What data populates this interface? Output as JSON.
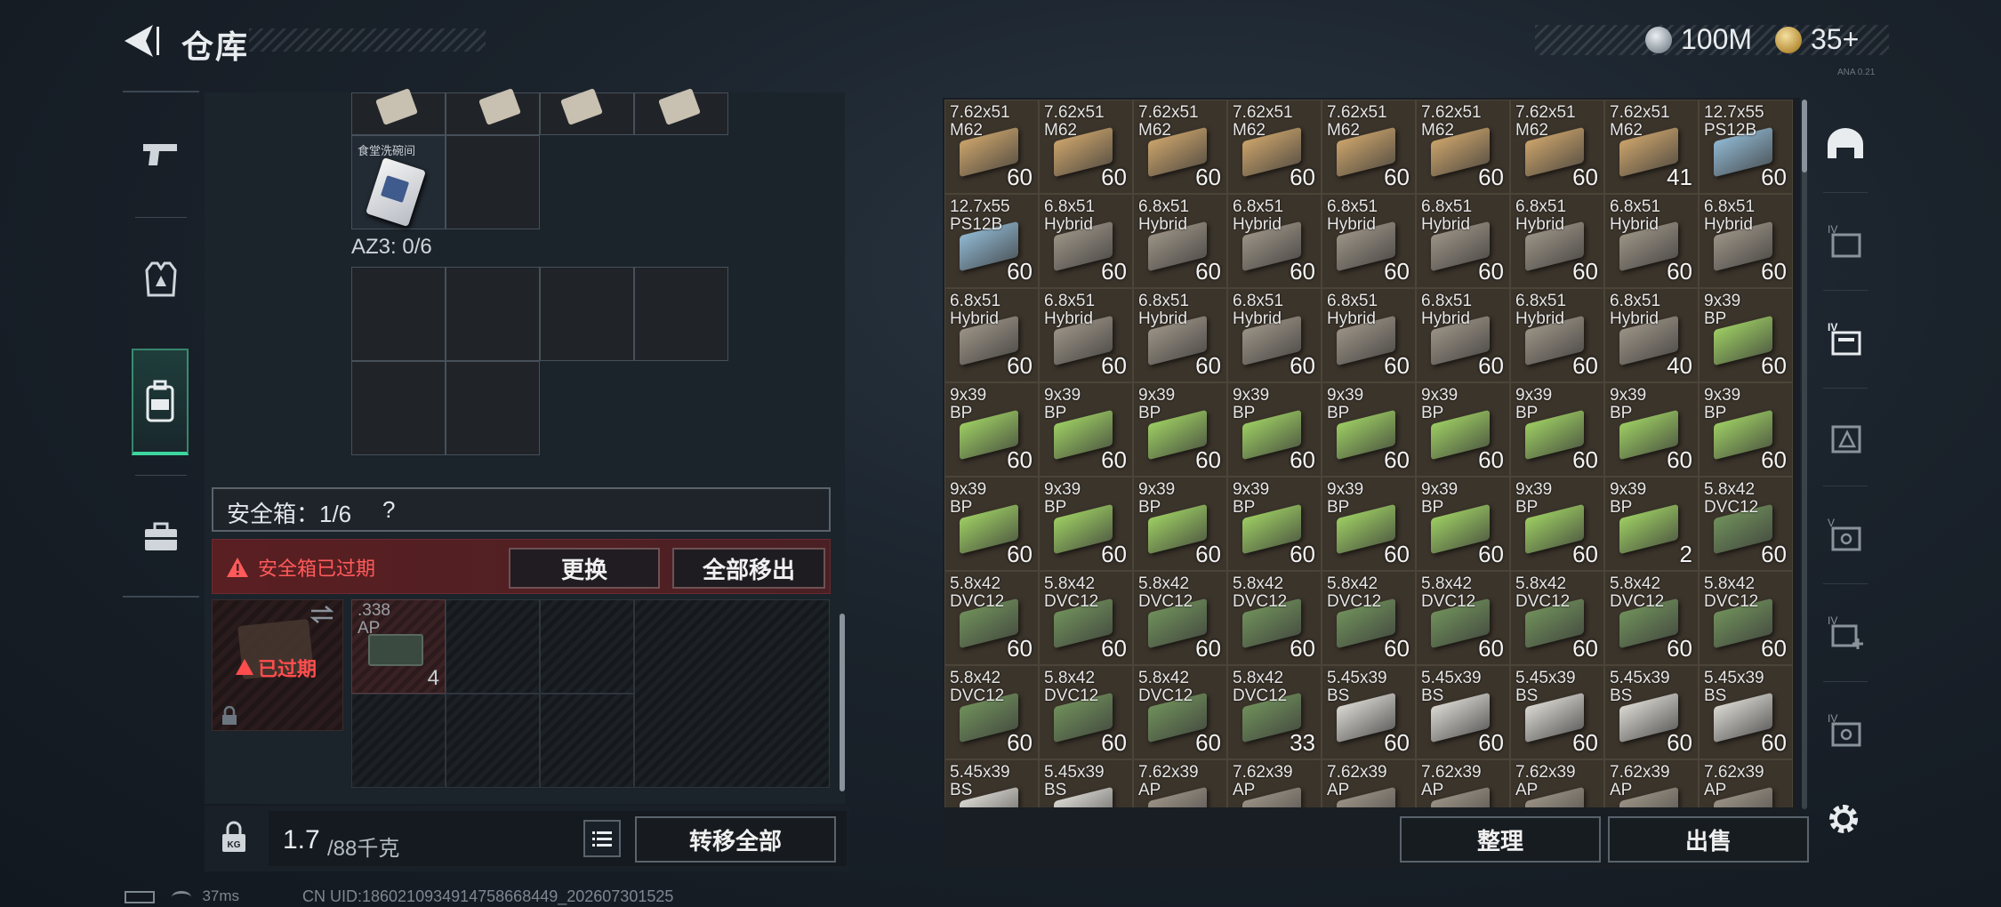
{
  "header": {
    "title": "仓库",
    "silver_value": "100M",
    "gold_value": "35+",
    "version_text": "ANA 0.21"
  },
  "left_nav": {
    "items": [
      {
        "name": "weapon-icon"
      },
      {
        "name": "vest-icon"
      },
      {
        "name": "backpack-icon",
        "active": true
      },
      {
        "name": "toolbox-icon"
      }
    ]
  },
  "container": {
    "item_label": "食堂洗碗间",
    "az3_label": "AZ3: 0/6",
    "safe_label": "安全箱：1/6",
    "help_mark": "?",
    "warning": "安全箱已过期",
    "replace_btn": "更换",
    "remove_all_btn": "全部移出",
    "expired_label": "已过期",
    "safe_item": {
      "name": ".338",
      "name2": "AP",
      "count": "4"
    }
  },
  "weight": {
    "current": "1.7",
    "max": "/88千克",
    "kg_badge": "KG"
  },
  "transfer_all_btn": "转移全部",
  "sort_btn": "整理",
  "sell_btn": "出售",
  "colors": {
    "tan_box": "#c9a26a",
    "blue_box": "#8fb6cf",
    "grey_box": "#9a9184",
    "green_box": "#9ccc62",
    "dark_green_box": "#6f8f5a",
    "white_box": "#d8d6d0",
    "warning_red": "#ff5a5a",
    "active_green": "#3dd6a0"
  },
  "stash": {
    "rows": [
      [
        {
          "n1": "7.62x51",
          "n2": "M62",
          "c": "60",
          "color": "tan"
        },
        {
          "n1": "7.62x51",
          "n2": "M62",
          "c": "60",
          "color": "tan"
        },
        {
          "n1": "7.62x51",
          "n2": "M62",
          "c": "60",
          "color": "tan"
        },
        {
          "n1": "7.62x51",
          "n2": "M62",
          "c": "60",
          "color": "tan"
        },
        {
          "n1": "7.62x51",
          "n2": "M62",
          "c": "60",
          "color": "tan"
        },
        {
          "n1": "7.62x51",
          "n2": "M62",
          "c": "60",
          "color": "tan"
        },
        {
          "n1": "7.62x51",
          "n2": "M62",
          "c": "60",
          "color": "tan"
        },
        {
          "n1": "7.62x51",
          "n2": "M62",
          "c": "41",
          "color": "tan"
        },
        {
          "n1": "12.7x55",
          "n2": "PS12B",
          "c": "60",
          "color": "blue"
        }
      ],
      [
        {
          "n1": "12.7x55",
          "n2": "PS12B",
          "c": "60",
          "color": "blue"
        },
        {
          "n1": "6.8x51",
          "n2": "Hybrid",
          "c": "60",
          "color": "grey"
        },
        {
          "n1": "6.8x51",
          "n2": "Hybrid",
          "c": "60",
          "color": "grey"
        },
        {
          "n1": "6.8x51",
          "n2": "Hybrid",
          "c": "60",
          "color": "grey"
        },
        {
          "n1": "6.8x51",
          "n2": "Hybrid",
          "c": "60",
          "color": "grey"
        },
        {
          "n1": "6.8x51",
          "n2": "Hybrid",
          "c": "60",
          "color": "grey"
        },
        {
          "n1": "6.8x51",
          "n2": "Hybrid",
          "c": "60",
          "color": "grey"
        },
        {
          "n1": "6.8x51",
          "n2": "Hybrid",
          "c": "60",
          "color": "grey"
        },
        {
          "n1": "6.8x51",
          "n2": "Hybrid",
          "c": "60",
          "color": "grey"
        }
      ],
      [
        {
          "n1": "6.8x51",
          "n2": "Hybrid",
          "c": "60",
          "color": "grey"
        },
        {
          "n1": "6.8x51",
          "n2": "Hybrid",
          "c": "60",
          "color": "grey"
        },
        {
          "n1": "6.8x51",
          "n2": "Hybrid",
          "c": "60",
          "color": "grey"
        },
        {
          "n1": "6.8x51",
          "n2": "Hybrid",
          "c": "60",
          "color": "grey"
        },
        {
          "n1": "6.8x51",
          "n2": "Hybrid",
          "c": "60",
          "color": "grey"
        },
        {
          "n1": "6.8x51",
          "n2": "Hybrid",
          "c": "60",
          "color": "grey"
        },
        {
          "n1": "6.8x51",
          "n2": "Hybrid",
          "c": "60",
          "color": "grey"
        },
        {
          "n1": "6.8x51",
          "n2": "Hybrid",
          "c": "40",
          "color": "grey"
        },
        {
          "n1": "9x39",
          "n2": "BP",
          "c": "60",
          "color": "green"
        }
      ],
      [
        {
          "n1": "9x39",
          "n2": "BP",
          "c": "60",
          "color": "green"
        },
        {
          "n1": "9x39",
          "n2": "BP",
          "c": "60",
          "color": "green"
        },
        {
          "n1": "9x39",
          "n2": "BP",
          "c": "60",
          "color": "green"
        },
        {
          "n1": "9x39",
          "n2": "BP",
          "c": "60",
          "color": "green"
        },
        {
          "n1": "9x39",
          "n2": "BP",
          "c": "60",
          "color": "green"
        },
        {
          "n1": "9x39",
          "n2": "BP",
          "c": "60",
          "color": "green"
        },
        {
          "n1": "9x39",
          "n2": "BP",
          "c": "60",
          "color": "green"
        },
        {
          "n1": "9x39",
          "n2": "BP",
          "c": "60",
          "color": "green"
        },
        {
          "n1": "9x39",
          "n2": "BP",
          "c": "60",
          "color": "green"
        }
      ],
      [
        {
          "n1": "9x39",
          "n2": "BP",
          "c": "60",
          "color": "green"
        },
        {
          "n1": "9x39",
          "n2": "BP",
          "c": "60",
          "color": "green"
        },
        {
          "n1": "9x39",
          "n2": "BP",
          "c": "60",
          "color": "green"
        },
        {
          "n1": "9x39",
          "n2": "BP",
          "c": "60",
          "color": "green"
        },
        {
          "n1": "9x39",
          "n2": "BP",
          "c": "60",
          "color": "green"
        },
        {
          "n1": "9x39",
          "n2": "BP",
          "c": "60",
          "color": "green"
        },
        {
          "n1": "9x39",
          "n2": "BP",
          "c": "60",
          "color": "green"
        },
        {
          "n1": "9x39",
          "n2": "BP",
          "c": "2",
          "color": "green"
        },
        {
          "n1": "5.8x42",
          "n2": "DVC12",
          "c": "60",
          "color": "darkgreen"
        }
      ],
      [
        {
          "n1": "5.8x42",
          "n2": "DVC12",
          "c": "60",
          "color": "darkgreen"
        },
        {
          "n1": "5.8x42",
          "n2": "DVC12",
          "c": "60",
          "color": "darkgreen"
        },
        {
          "n1": "5.8x42",
          "n2": "DVC12",
          "c": "60",
          "color": "darkgreen"
        },
        {
          "n1": "5.8x42",
          "n2": "DVC12",
          "c": "60",
          "color": "darkgreen"
        },
        {
          "n1": "5.8x42",
          "n2": "DVC12",
          "c": "60",
          "color": "darkgreen"
        },
        {
          "n1": "5.8x42",
          "n2": "DVC12",
          "c": "60",
          "color": "darkgreen"
        },
        {
          "n1": "5.8x42",
          "n2": "DVC12",
          "c": "60",
          "color": "darkgreen"
        },
        {
          "n1": "5.8x42",
          "n2": "DVC12",
          "c": "60",
          "color": "darkgreen"
        },
        {
          "n1": "5.8x42",
          "n2": "DVC12",
          "c": "60",
          "color": "darkgreen"
        }
      ],
      [
        {
          "n1": "5.8x42",
          "n2": "DVC12",
          "c": "60",
          "color": "darkgreen"
        },
        {
          "n1": "5.8x42",
          "n2": "DVC12",
          "c": "60",
          "color": "darkgreen"
        },
        {
          "n1": "5.8x42",
          "n2": "DVC12",
          "c": "60",
          "color": "darkgreen"
        },
        {
          "n1": "5.8x42",
          "n2": "DVC12",
          "c": "33",
          "color": "darkgreen"
        },
        {
          "n1": "5.45x39",
          "n2": "BS",
          "c": "60",
          "color": "white"
        },
        {
          "n1": "5.45x39",
          "n2": "BS",
          "c": "60",
          "color": "white"
        },
        {
          "n1": "5.45x39",
          "n2": "BS",
          "c": "60",
          "color": "white"
        },
        {
          "n1": "5.45x39",
          "n2": "BS",
          "c": "60",
          "color": "white"
        },
        {
          "n1": "5.45x39",
          "n2": "BS",
          "c": "60",
          "color": "white"
        }
      ],
      [
        {
          "n1": "5.45x39",
          "n2": "BS",
          "c": "",
          "color": "white"
        },
        {
          "n1": "5.45x39",
          "n2": "BS",
          "c": "",
          "color": "white"
        },
        {
          "n1": "7.62x39",
          "n2": "AP",
          "c": "",
          "color": "grey"
        },
        {
          "n1": "7.62x39",
          "n2": "AP",
          "c": "",
          "color": "grey"
        },
        {
          "n1": "7.62x39",
          "n2": "AP",
          "c": "",
          "color": "grey"
        },
        {
          "n1": "7.62x39",
          "n2": "AP",
          "c": "",
          "color": "grey"
        },
        {
          "n1": "7.62x39",
          "n2": "AP",
          "c": "",
          "color": "grey"
        },
        {
          "n1": "7.62x39",
          "n2": "AP",
          "c": "",
          "color": "grey"
        },
        {
          "n1": "7.62x39",
          "n2": "AP",
          "c": "",
          "color": "grey"
        }
      ]
    ]
  },
  "right_nav": {
    "items": [
      {
        "name": "helmet-icon"
      },
      {
        "name": "storage-iv-icon"
      },
      {
        "name": "storage-iv-active-icon"
      },
      {
        "name": "storage-gift-icon"
      },
      {
        "name": "storage-v-icon"
      },
      {
        "name": "storage-add-icon"
      },
      {
        "name": "storage-iv-search-icon"
      }
    ]
  },
  "status_bar": {
    "ping": "37ms",
    "uid": "CN UID:1860210934914758668449_202607301525"
  }
}
